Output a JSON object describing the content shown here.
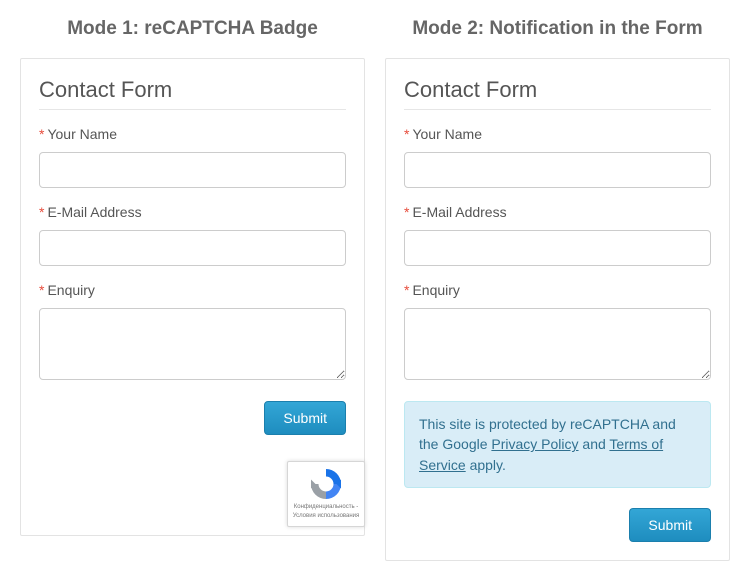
{
  "mode1": {
    "title": "Mode 1: reCAPTCHA Badge",
    "form_title": "Contact Form",
    "fields": {
      "name_label": "Your Name",
      "email_label": "E-Mail Address",
      "enquiry_label": "Enquiry"
    },
    "submit_label": "Submit",
    "badge_line1": "Конфиденциальность -",
    "badge_line2": "Условия использования"
  },
  "mode2": {
    "title": "Mode 2: Notification in the Form",
    "form_title": "Contact Form",
    "fields": {
      "name_label": "Your Name",
      "email_label": "E-Mail Address",
      "enquiry_label": "Enquiry"
    },
    "notice_text1": "This site is protected by reCAPTCHA and the Google ",
    "notice_link1": "Privacy Policy",
    "notice_text2": " and ",
    "notice_link2": "Terms of Service",
    "notice_text3": " apply.",
    "submit_label": "Submit"
  },
  "required_mark": "*"
}
